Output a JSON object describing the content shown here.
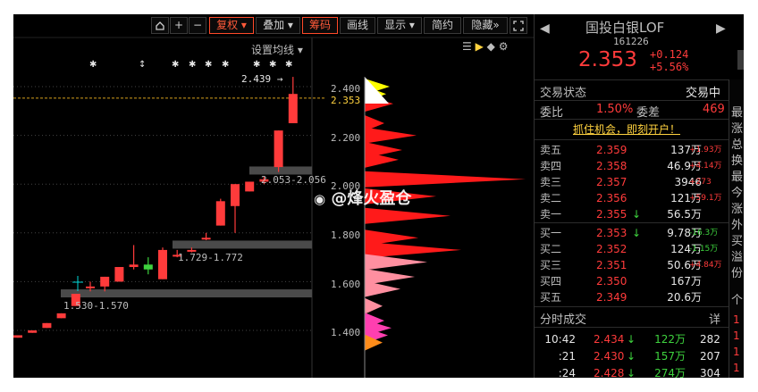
{
  "toolbar": {
    "home_icon": "home-icon",
    "plus_label": "+",
    "minus_label": "−",
    "fq_label": "复权",
    "overlay_label": "叠加",
    "chips_label": "筹码",
    "draw_label": "画线",
    "display_label": "显示",
    "simple_label": "简约",
    "hide_label": "隐藏",
    "expand_icon": "expand-icon"
  },
  "chart": {
    "settings_label": "设置均线",
    "markers": [
      "✱",
      "↕",
      "✱",
      "✱",
      "✱",
      "✱",
      "✱",
      "✱",
      "✱"
    ],
    "price_labels": [
      "2.400",
      "2.353",
      "2.200",
      "2.000",
      "1.800",
      "1.600",
      "1.400"
    ],
    "high_label": "2.439",
    "range_labels": [
      "2.053-2.056",
      "1.729-1.772",
      "1.530-1.570"
    ],
    "watermark": "@烽火盈仓"
  },
  "chart_data": {
    "type": "candlestick",
    "title": "",
    "current_price": 2.353,
    "ylim": [
      1.33,
      2.52
    ],
    "candles": [
      {
        "o": 1.37,
        "c": 1.38,
        "h": 1.38,
        "l": 1.37
      },
      {
        "o": 1.39,
        "c": 1.4,
        "h": 1.4,
        "l": 1.39
      },
      {
        "o": 1.41,
        "c": 1.43,
        "h": 1.43,
        "l": 1.41
      },
      {
        "o": 1.45,
        "c": 1.47,
        "h": 1.47,
        "l": 1.45
      },
      {
        "o": 1.5,
        "c": 1.55,
        "h": 1.55,
        "l": 1.5
      },
      {
        "o": 1.58,
        "c": 1.58,
        "h": 1.6,
        "l": 1.56
      },
      {
        "o": 1.58,
        "c": 1.62,
        "h": 1.62,
        "l": 1.56
      },
      {
        "o": 1.6,
        "c": 1.66,
        "h": 1.66,
        "l": 1.6
      },
      {
        "o": 1.66,
        "c": 1.67,
        "h": 1.75,
        "l": 1.65
      },
      {
        "o": 1.67,
        "c": 1.65,
        "h": 1.7,
        "l": 1.63
      },
      {
        "o": 1.61,
        "c": 1.73,
        "h": 1.74,
        "l": 1.61
      },
      {
        "o": 1.71,
        "c": 1.71,
        "h": 1.73,
        "l": 1.7
      },
      {
        "o": 1.73,
        "c": 1.73,
        "h": 1.74,
        "l": 1.72
      },
      {
        "o": 1.78,
        "c": 1.78,
        "h": 1.8,
        "l": 1.77
      },
      {
        "o": 1.83,
        "c": 1.93,
        "h": 1.94,
        "l": 1.83
      },
      {
        "o": 1.91,
        "c": 2.0,
        "h": 2.0,
        "l": 1.8
      },
      {
        "o": 1.97,
        "c": 2.01,
        "h": 2.01,
        "l": 1.97
      },
      {
        "o": 2.01,
        "c": 2.02,
        "h": 2.03,
        "l": 2.0
      },
      {
        "o": 2.07,
        "c": 2.22,
        "h": 2.22,
        "l": 2.05
      },
      {
        "o": 2.25,
        "c": 2.37,
        "h": 2.44,
        "l": 2.25
      }
    ],
    "chips_levels": [
      {
        "price": 2.4,
        "width": 28
      },
      {
        "price": 2.37,
        "width": 24
      },
      {
        "price": 2.33,
        "width": 32
      },
      {
        "price": 2.25,
        "width": 22
      },
      {
        "price": 2.2,
        "width": 58
      },
      {
        "price": 2.14,
        "width": 42
      },
      {
        "price": 2.1,
        "width": 38
      },
      {
        "price": 2.02,
        "width": 180
      },
      {
        "price": 1.95,
        "width": 80
      },
      {
        "price": 1.87,
        "width": 96
      },
      {
        "price": 1.78,
        "width": 60
      },
      {
        "price": 1.73,
        "width": 108
      },
      {
        "price": 1.68,
        "width": 70
      },
      {
        "price": 1.62,
        "width": 56
      },
      {
        "price": 1.57,
        "width": 40
      },
      {
        "price": 1.5,
        "width": 20
      },
      {
        "price": 1.44,
        "width": 22
      },
      {
        "price": 1.41,
        "width": 30
      },
      {
        "price": 1.38,
        "width": 26
      },
      {
        "price": 1.35,
        "width": 20
      }
    ]
  },
  "quote": {
    "name": "国投白银LOF",
    "code": "161226",
    "price": "2.353",
    "change": "+0.124",
    "pct": "+5.56%",
    "status_label": "交易状态",
    "status_value": "交易中",
    "weibi_label": "委比",
    "weibi_value": "1.50%",
    "weicha_label": "委差",
    "weicha_value": "469",
    "promo": "抓住机会，即刻开户！"
  },
  "sells": [
    {
      "label": "卖五",
      "price": "2.359",
      "vol": "137万",
      "chg": "+1.93万",
      "arrow": ""
    },
    {
      "label": "卖四",
      "price": "2.358",
      "vol": "46.9万",
      "chg": "+4.14万",
      "arrow": ""
    },
    {
      "label": "卖三",
      "price": "2.357",
      "vol": "3946",
      "chg": "+273",
      "arrow": ""
    },
    {
      "label": "卖二",
      "price": "2.356",
      "vol": "121万",
      "chg": "+59.1万",
      "arrow": ""
    },
    {
      "label": "卖一",
      "price": "2.355",
      "vol": "56.5万",
      "chg": "",
      "arrow": "↓"
    }
  ],
  "buys": [
    {
      "label": "买一",
      "price": "2.353",
      "vol": "9.78万",
      "chg": "-16.3万",
      "arrow": "↓"
    },
    {
      "label": "买二",
      "price": "2.352",
      "vol": "124万",
      "chg": "-1.15万",
      "arrow": ""
    },
    {
      "label": "买三",
      "price": "2.351",
      "vol": "50.6万",
      "chg": "+4.84万",
      "arrow": ""
    },
    {
      "label": "买四",
      "price": "2.350",
      "vol": "167万",
      "chg": "",
      "arrow": ""
    },
    {
      "label": "买五",
      "price": "2.349",
      "vol": "20.6万",
      "chg": "",
      "arrow": ""
    }
  ],
  "ticks": {
    "title": "分时成交",
    "detail": "详",
    "rows": [
      {
        "time": "10:42",
        "price": "2.434",
        "arrow": "↓",
        "vol": "122万",
        "count": "282"
      },
      {
        "time": ":21",
        "price": "2.430",
        "arrow": "↓",
        "vol": "157万",
        "count": "207"
      },
      {
        "time": ":24",
        "price": "2.428",
        "arrow": "↓",
        "vol": "274万",
        "count": "304"
      }
    ]
  },
  "side": {
    "chars": [
      "最",
      "涨",
      "总",
      "换",
      "最",
      "今",
      "涨",
      "外",
      "买",
      "溢",
      "份"
    ],
    "tab": "个",
    "nums": [
      "1",
      "1",
      "1",
      "1"
    ]
  },
  "colors": {
    "up": "#ff3b3b",
    "down": "#3ed33e",
    "chips_yellow": "#ffff00",
    "chips_red": "#ff1a1a",
    "chips_pink": "#ff8fa0"
  }
}
